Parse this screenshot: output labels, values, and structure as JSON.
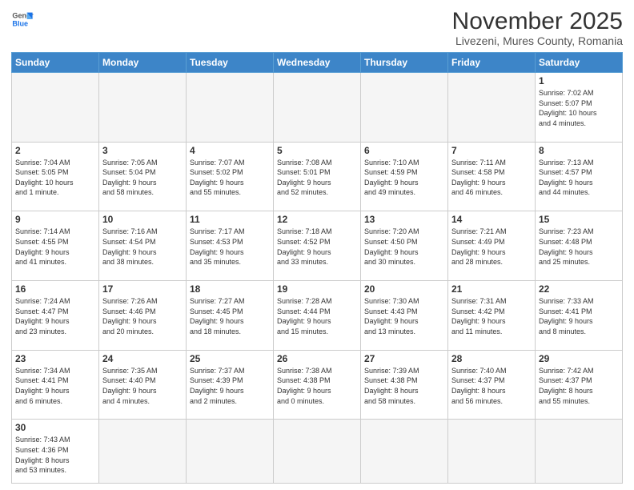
{
  "header": {
    "logo_general": "General",
    "logo_blue": "Blue",
    "month_title": "November 2025",
    "location": "Livezeni, Mures County, Romania"
  },
  "days_of_week": [
    "Sunday",
    "Monday",
    "Tuesday",
    "Wednesday",
    "Thursday",
    "Friday",
    "Saturday"
  ],
  "weeks": [
    [
      {
        "day": "",
        "info": ""
      },
      {
        "day": "",
        "info": ""
      },
      {
        "day": "",
        "info": ""
      },
      {
        "day": "",
        "info": ""
      },
      {
        "day": "",
        "info": ""
      },
      {
        "day": "",
        "info": ""
      },
      {
        "day": "1",
        "info": "Sunrise: 7:02 AM\nSunset: 5:07 PM\nDaylight: 10 hours\nand 4 minutes."
      }
    ],
    [
      {
        "day": "2",
        "info": "Sunrise: 7:04 AM\nSunset: 5:05 PM\nDaylight: 10 hours\nand 1 minute."
      },
      {
        "day": "3",
        "info": "Sunrise: 7:05 AM\nSunset: 5:04 PM\nDaylight: 9 hours\nand 58 minutes."
      },
      {
        "day": "4",
        "info": "Sunrise: 7:07 AM\nSunset: 5:02 PM\nDaylight: 9 hours\nand 55 minutes."
      },
      {
        "day": "5",
        "info": "Sunrise: 7:08 AM\nSunset: 5:01 PM\nDaylight: 9 hours\nand 52 minutes."
      },
      {
        "day": "6",
        "info": "Sunrise: 7:10 AM\nSunset: 4:59 PM\nDaylight: 9 hours\nand 49 minutes."
      },
      {
        "day": "7",
        "info": "Sunrise: 7:11 AM\nSunset: 4:58 PM\nDaylight: 9 hours\nand 46 minutes."
      },
      {
        "day": "8",
        "info": "Sunrise: 7:13 AM\nSunset: 4:57 PM\nDaylight: 9 hours\nand 44 minutes."
      }
    ],
    [
      {
        "day": "9",
        "info": "Sunrise: 7:14 AM\nSunset: 4:55 PM\nDaylight: 9 hours\nand 41 minutes."
      },
      {
        "day": "10",
        "info": "Sunrise: 7:16 AM\nSunset: 4:54 PM\nDaylight: 9 hours\nand 38 minutes."
      },
      {
        "day": "11",
        "info": "Sunrise: 7:17 AM\nSunset: 4:53 PM\nDaylight: 9 hours\nand 35 minutes."
      },
      {
        "day": "12",
        "info": "Sunrise: 7:18 AM\nSunset: 4:52 PM\nDaylight: 9 hours\nand 33 minutes."
      },
      {
        "day": "13",
        "info": "Sunrise: 7:20 AM\nSunset: 4:50 PM\nDaylight: 9 hours\nand 30 minutes."
      },
      {
        "day": "14",
        "info": "Sunrise: 7:21 AM\nSunset: 4:49 PM\nDaylight: 9 hours\nand 28 minutes."
      },
      {
        "day": "15",
        "info": "Sunrise: 7:23 AM\nSunset: 4:48 PM\nDaylight: 9 hours\nand 25 minutes."
      }
    ],
    [
      {
        "day": "16",
        "info": "Sunrise: 7:24 AM\nSunset: 4:47 PM\nDaylight: 9 hours\nand 23 minutes."
      },
      {
        "day": "17",
        "info": "Sunrise: 7:26 AM\nSunset: 4:46 PM\nDaylight: 9 hours\nand 20 minutes."
      },
      {
        "day": "18",
        "info": "Sunrise: 7:27 AM\nSunset: 4:45 PM\nDaylight: 9 hours\nand 18 minutes."
      },
      {
        "day": "19",
        "info": "Sunrise: 7:28 AM\nSunset: 4:44 PM\nDaylight: 9 hours\nand 15 minutes."
      },
      {
        "day": "20",
        "info": "Sunrise: 7:30 AM\nSunset: 4:43 PM\nDaylight: 9 hours\nand 13 minutes."
      },
      {
        "day": "21",
        "info": "Sunrise: 7:31 AM\nSunset: 4:42 PM\nDaylight: 9 hours\nand 11 minutes."
      },
      {
        "day": "22",
        "info": "Sunrise: 7:33 AM\nSunset: 4:41 PM\nDaylight: 9 hours\nand 8 minutes."
      }
    ],
    [
      {
        "day": "23",
        "info": "Sunrise: 7:34 AM\nSunset: 4:41 PM\nDaylight: 9 hours\nand 6 minutes."
      },
      {
        "day": "24",
        "info": "Sunrise: 7:35 AM\nSunset: 4:40 PM\nDaylight: 9 hours\nand 4 minutes."
      },
      {
        "day": "25",
        "info": "Sunrise: 7:37 AM\nSunset: 4:39 PM\nDaylight: 9 hours\nand 2 minutes."
      },
      {
        "day": "26",
        "info": "Sunrise: 7:38 AM\nSunset: 4:38 PM\nDaylight: 9 hours\nand 0 minutes."
      },
      {
        "day": "27",
        "info": "Sunrise: 7:39 AM\nSunset: 4:38 PM\nDaylight: 8 hours\nand 58 minutes."
      },
      {
        "day": "28",
        "info": "Sunrise: 7:40 AM\nSunset: 4:37 PM\nDaylight: 8 hours\nand 56 minutes."
      },
      {
        "day": "29",
        "info": "Sunrise: 7:42 AM\nSunset: 4:37 PM\nDaylight: 8 hours\nand 55 minutes."
      }
    ],
    [
      {
        "day": "30",
        "info": "Sunrise: 7:43 AM\nSunset: 4:36 PM\nDaylight: 8 hours\nand 53 minutes."
      },
      {
        "day": "",
        "info": ""
      },
      {
        "day": "",
        "info": ""
      },
      {
        "day": "",
        "info": ""
      },
      {
        "day": "",
        "info": ""
      },
      {
        "day": "",
        "info": ""
      },
      {
        "day": "",
        "info": ""
      }
    ]
  ]
}
